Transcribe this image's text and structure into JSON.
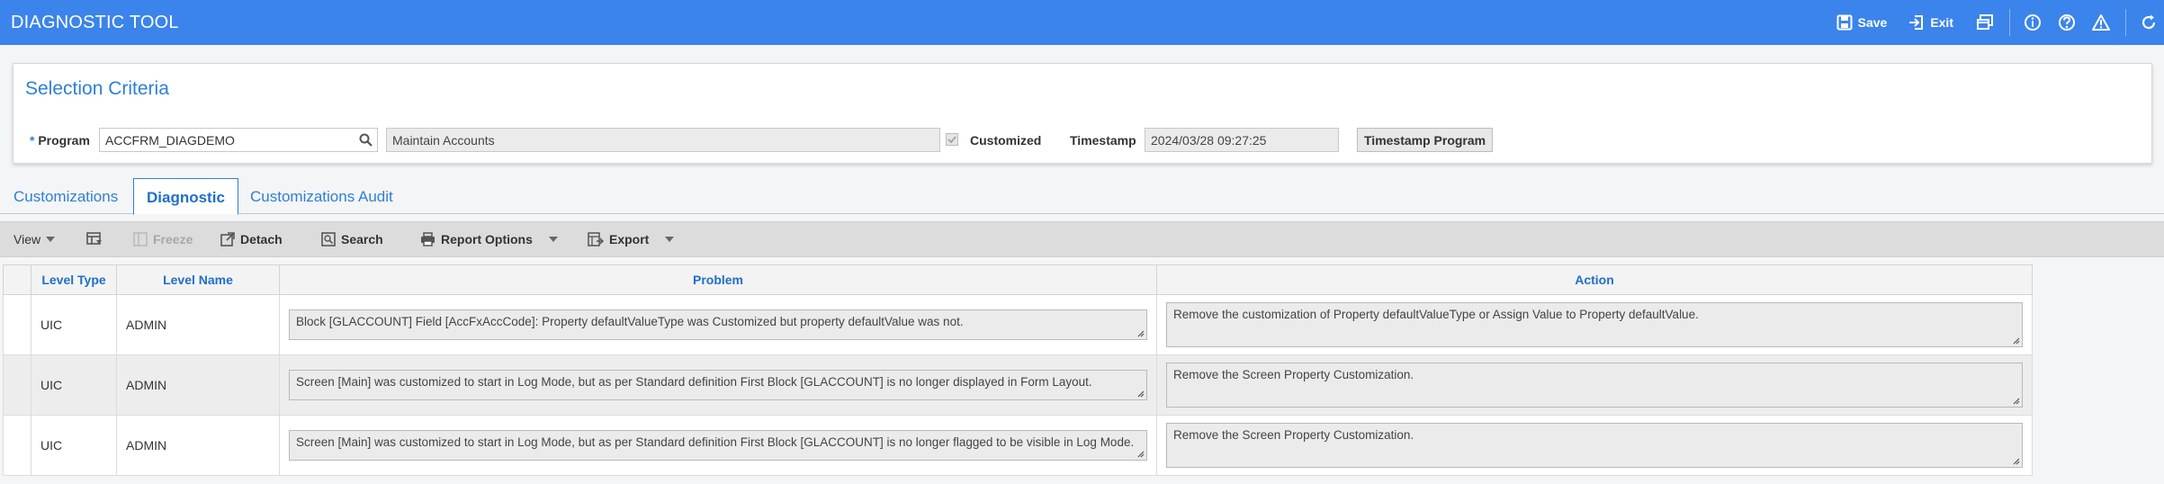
{
  "header": {
    "title": "DIAGNOSTIC TOOL",
    "save_label": "Save",
    "exit_label": "Exit"
  },
  "criteria": {
    "title": "Selection Criteria",
    "required_mark": "*",
    "program_label": "Program",
    "program_value": "ACCFRM_DIAGDEMO",
    "program_description": "Maintain Accounts",
    "customized_label": "Customized",
    "customized_checked": true,
    "timestamp_label": "Timestamp",
    "timestamp_value": "2024/03/28 09:27:25",
    "timestamp_button": "Timestamp Program"
  },
  "tabs": [
    {
      "label": "Customizations",
      "active": false
    },
    {
      "label": "Diagnostic",
      "active": true
    },
    {
      "label": "Customizations Audit",
      "active": false
    }
  ],
  "toolbar": {
    "view": "View",
    "freeze": "Freeze",
    "detach": "Detach",
    "search": "Search",
    "report_options": "Report Options",
    "export": "Export"
  },
  "grid": {
    "columns": [
      "Level Type",
      "Level Name",
      "Problem",
      "Action"
    ],
    "rows": [
      {
        "level_type": "UIC",
        "level_name": "ADMIN",
        "problem": "Block [GLACCOUNT] Field [AccFxAccCode]: Property defaultValueType was Customized but property defaultValue was not.",
        "action": "Remove the customization of Property defaultValueType or Assign Value to Property defaultValue."
      },
      {
        "level_type": "UIC",
        "level_name": "ADMIN",
        "problem": "Screen [Main] was customized to start in Log Mode, but as per Standard definition First Block [GLACCOUNT] is no longer displayed in Form Layout.",
        "action": "Remove the Screen Property Customization."
      },
      {
        "level_type": "UIC",
        "level_name": "ADMIN",
        "problem": "Screen [Main] was customized to start in Log Mode, but as per Standard definition First Block [GLACCOUNT] is no longer flagged to be visible in Log Mode.",
        "action": "Remove the Screen Property Customization."
      }
    ]
  },
  "colors": {
    "topbar": "#3b84eb",
    "accent": "#2e7fd8"
  }
}
